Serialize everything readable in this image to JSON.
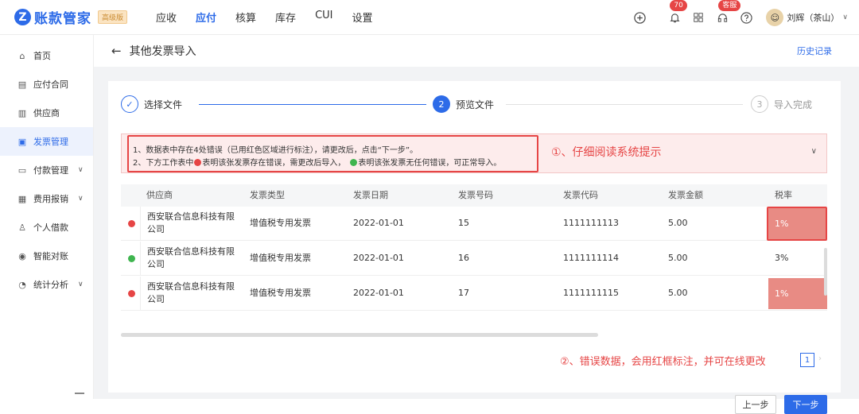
{
  "brand": {
    "name": "账款管家",
    "badge": "高级版"
  },
  "topnav": [
    "应收",
    "应付",
    "核算",
    "库存",
    "CUI",
    "设置"
  ],
  "topnav_active": 1,
  "topbar": {
    "notifications": "70",
    "service_label": "客服",
    "user": "刘辉（茶山）"
  },
  "sidebar": [
    {
      "label": "首页",
      "icon": "home-icon",
      "glyph": "⌂",
      "active": false,
      "chevron": false
    },
    {
      "label": "应付合同",
      "icon": "contract-icon",
      "glyph": "▤",
      "active": false,
      "chevron": false
    },
    {
      "label": "供应商",
      "icon": "supplier-icon",
      "glyph": "▥",
      "active": false,
      "chevron": false
    },
    {
      "label": "发票管理",
      "icon": "invoice-icon",
      "glyph": "▣",
      "active": true,
      "chevron": false
    },
    {
      "label": "付款管理",
      "icon": "payment-icon",
      "glyph": "▭",
      "active": false,
      "chevron": true
    },
    {
      "label": "费用报销",
      "icon": "expense-icon",
      "glyph": "▦",
      "active": false,
      "chevron": true
    },
    {
      "label": "个人借款",
      "icon": "person-icon",
      "glyph": "♙",
      "active": false,
      "chevron": false
    },
    {
      "label": "智能对账",
      "icon": "reconcile-icon",
      "glyph": "◉",
      "active": false,
      "chevron": false
    },
    {
      "label": "统计分析",
      "icon": "chart-icon",
      "glyph": "◔",
      "active": false,
      "chevron": true
    }
  ],
  "page": {
    "title": "其他发票导入",
    "history": "历史记录"
  },
  "steps": [
    {
      "label": "选择文件",
      "num": "✓",
      "state": "done"
    },
    {
      "label": "预览文件",
      "num": "2",
      "state": "current"
    },
    {
      "label": "导入完成",
      "num": "3",
      "state": "todo"
    }
  ],
  "alert": {
    "line1": "1、数据表中存在4处错误（已用红色区域进行标注），请更改后，点击“下一步”。",
    "line2_a": "2、下方工作表中",
    "line2_b": "表明该张发票存在错误，需更改后导入，",
    "line2_c": "表明该张发票无任何错误，可正常导入。",
    "annotation": "①、仔细阅读系统提示"
  },
  "table": {
    "columns": [
      "供应商",
      "发票类型",
      "发票日期",
      "发票号码",
      "发票代码",
      "发票金额",
      "税率"
    ],
    "rows": [
      {
        "status": "error",
        "supplier": "西安联合信息科技有限公司",
        "type": "增值税专用发票",
        "date": "2022-01-01",
        "number": "15",
        "code": "1111111113",
        "amount": "5.00",
        "rate": "1%",
        "rate_error": true
      },
      {
        "status": "ok",
        "supplier": "西安联合信息科技有限公司",
        "type": "增值税专用发票",
        "date": "2022-01-01",
        "number": "16",
        "code": "1111111114",
        "amount": "5.00",
        "rate": "3%",
        "rate_error": false
      },
      {
        "status": "error",
        "supplier": "西安联合信息科技有限公司",
        "type": "增值税专用发票",
        "date": "2022-01-01",
        "number": "17",
        "code": "1111111115",
        "amount": "5.00",
        "rate": "1%",
        "rate_error": true
      }
    ]
  },
  "annotation2": "②、错误数据，会用红框标注，并可在线更改",
  "pagination": {
    "current": "1"
  },
  "buttons": {
    "prev": "上一步",
    "next": "下一步"
  },
  "colors": {
    "primary": "#2d6be8",
    "error": "#e64545",
    "ok": "#3fb54f",
    "error_fill": "#e88b84"
  }
}
